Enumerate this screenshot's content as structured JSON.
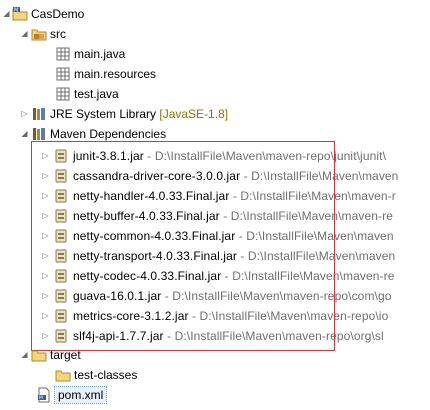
{
  "project": {
    "name": "CasDemo"
  },
  "src": {
    "label": "src",
    "packages": [
      "main.java",
      "main.resources",
      "test.java"
    ]
  },
  "jre": {
    "label": "JRE System Library",
    "decoration": "[JavaSE-1.8]"
  },
  "maven": {
    "label": "Maven Dependencies",
    "jars": [
      {
        "name": "junit-3.8.1.jar",
        "path": "D:\\InstallFile\\Maven\\maven-repo\\junit\\junit\\"
      },
      {
        "name": "cassandra-driver-core-3.0.0.jar",
        "path": "D:\\InstallFile\\Maven\\maven"
      },
      {
        "name": "netty-handler-4.0.33.Final.jar",
        "path": "D:\\InstallFile\\Maven\\maven-r"
      },
      {
        "name": "netty-buffer-4.0.33.Final.jar",
        "path": "D:\\InstallFile\\Maven\\maven-re"
      },
      {
        "name": "netty-common-4.0.33.Final.jar",
        "path": "D:\\InstallFile\\Maven\\maven"
      },
      {
        "name": "netty-transport-4.0.33.Final.jar",
        "path": "D:\\InstallFile\\Maven\\maven"
      },
      {
        "name": "netty-codec-4.0.33.Final.jar",
        "path": "D:\\InstallFile\\Maven\\maven-re"
      },
      {
        "name": "guava-16.0.1.jar",
        "path": "D:\\InstallFile\\Maven\\maven-repo\\com\\go"
      },
      {
        "name": "metrics-core-3.1.2.jar",
        "path": "D:\\InstallFile\\Maven\\maven-repo\\io"
      },
      {
        "name": "slf4j-api-1.7.7.jar",
        "path": "D:\\InstallFile\\Maven\\maven-repo\\org\\sl"
      }
    ]
  },
  "target": {
    "label": "target",
    "children": [
      "test-classes"
    ]
  },
  "pom": {
    "label": "pom.xml"
  },
  "icons": {
    "project": "maven-project-icon",
    "source-folder": "source-folder-icon",
    "package": "package-icon",
    "library": "library-icon",
    "jar": "jar-icon",
    "folder": "folder-icon",
    "xml-file": "xml-file-icon"
  },
  "colors": {
    "highlight_box": "#e03333",
    "decoration": "#8b7500",
    "path_text": "#6f6f6f"
  }
}
